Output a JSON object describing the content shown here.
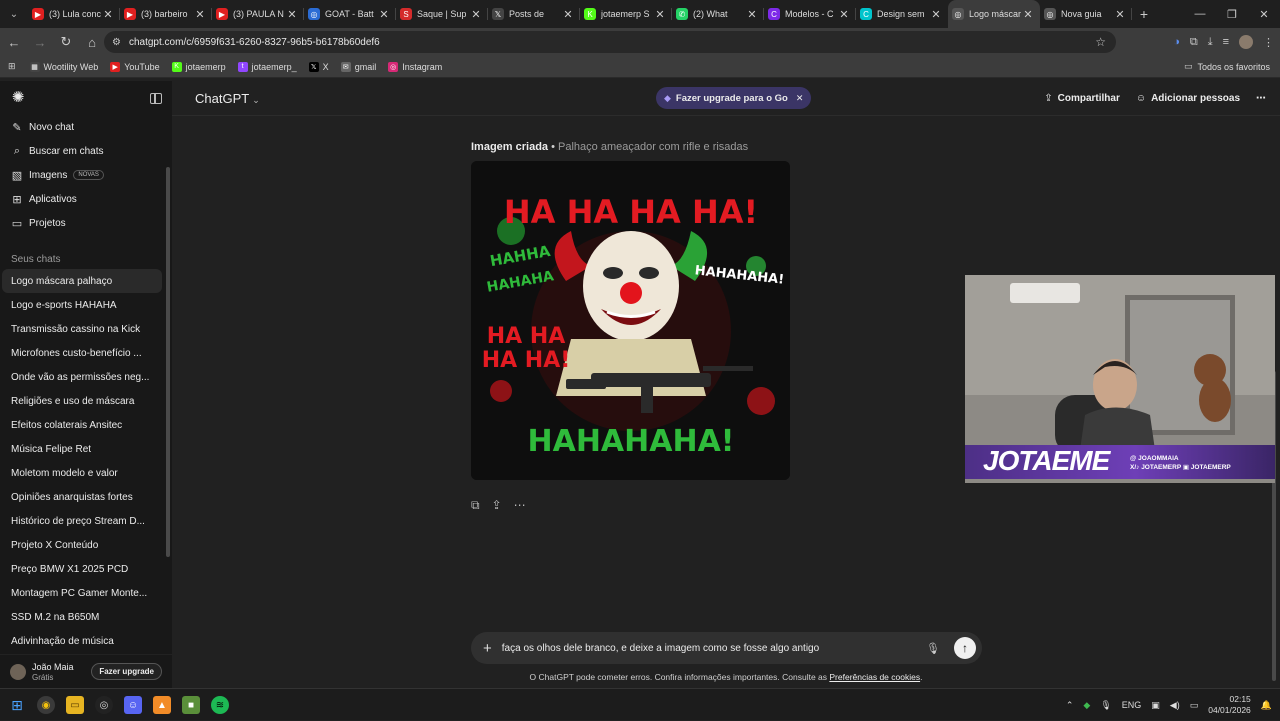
{
  "browser": {
    "tabs": [
      {
        "label": "(3) Lula conc",
        "fav_color": "#e02020",
        "fav": "▶"
      },
      {
        "label": "(3) barbeiro",
        "fav_color": "#e02020",
        "fav": "▶"
      },
      {
        "label": "(3) PAULA N",
        "fav_color": "#e02020",
        "fav": "▶"
      },
      {
        "label": "GOAT - Batt",
        "fav_color": "#2b6cd4",
        "fav": "◎"
      },
      {
        "label": "Saque | Sup",
        "fav_color": "#d42b2b",
        "fav": "S"
      },
      {
        "label": "Posts de",
        "fav_color": "#444444",
        "fav": "𝕏"
      },
      {
        "label": "jotaemerp S",
        "fav_color": "#53fc18",
        "fav": "K"
      },
      {
        "label": "(2) What",
        "fav_color": "#25d366",
        "fav": "✆"
      },
      {
        "label": "Modelos - C",
        "fav_color": "#7d2ae8",
        "fav": "C"
      },
      {
        "label": "Design sem",
        "fav_color": "#00c4cc",
        "fav": "C"
      },
      {
        "label": "Logo máscar",
        "fav_color": "#555555",
        "fav": "◎"
      },
      {
        "label": "Nova guia",
        "fav_color": "#555555",
        "fav": "◎"
      }
    ],
    "url": "chatgpt.com/c/6959f631-6260-8327-96b5-b6178b60def6",
    "bookmarks": [
      {
        "label": "Wootility Web",
        "color": "#444444",
        "icon": "▦"
      },
      {
        "label": "YouTube",
        "color": "#e02020",
        "icon": "▶"
      },
      {
        "label": "jotaemerp",
        "color": "#53fc18",
        "icon": "K"
      },
      {
        "label": "jotaemerp_",
        "color": "#9146ff",
        "icon": "t"
      },
      {
        "label": "X",
        "color": "#000000",
        "icon": "𝕏"
      },
      {
        "label": "gmail",
        "color": "#666666",
        "icon": "✉"
      },
      {
        "label": "Instagram",
        "color": "#d62976",
        "icon": "◎"
      }
    ],
    "all_favorites": "Todos os favoritos"
  },
  "sidebar": {
    "nav": [
      {
        "label": "Novo chat",
        "icon": "✎"
      },
      {
        "label": "Buscar em chats",
        "icon": "⌕"
      },
      {
        "label": "Imagens",
        "icon": "▧",
        "badge": "NOVAS"
      },
      {
        "label": "Aplicativos",
        "icon": "⊞"
      },
      {
        "label": "Projetos",
        "icon": "▭"
      }
    ],
    "section_label": "Seus chats",
    "chats": [
      "Logo máscara palhaço",
      "Logo e-sports HAHAHA",
      "Transmissão cassino na Kick",
      "Microfones custo-benefício ...",
      "Onde vão as permissões neg...",
      "Religiões e uso de máscara",
      "Efeitos colaterais Ansitec",
      "Música Felipe Ret",
      "Moletom modelo e valor",
      "Opiniões anarquistas fortes",
      "Histórico de preço Stream D...",
      "Projeto X Conteúdo",
      "Preço BMW X1 2025 PCD",
      "Montagem PC Gamer Monte...",
      "SSD M.2 na B650M",
      "Adivinhação de música"
    ],
    "user": {
      "name": "João Maia",
      "plan": "Grátis",
      "upgrade": "Fazer upgrade"
    }
  },
  "header": {
    "model": "ChatGPT",
    "upgrade_pill": "Fazer upgrade para o Go",
    "share": "Compartilhar",
    "add_people": "Adicionar pessoas"
  },
  "message": {
    "title_bold": "Imagem criada",
    "title_sep": " • ",
    "title_sub": "Palhaço ameaçador com rifle e risadas",
    "image_texts": {
      "top": "HA HA HA HA!",
      "left1": "HAHHA",
      "left2": "HAHAHA",
      "right": "HAHAHAHA!",
      "mid1": "HA HA",
      "mid2": "HA HA!",
      "bottom": "HAHAHAHA!"
    }
  },
  "composer": {
    "value": "faça os olhos dele branco, e deixe a imagem como se fosse algo antigo"
  },
  "disclaimer": {
    "text": "O ChatGPT pode cometer erros. Confira informações importantes. Consulte as ",
    "link": "Preferências de cookies",
    "end": "."
  },
  "webcam": {
    "logo": "JOTAEME",
    "social1": "@ JOAOMMAIA",
    "social2": "X/♪ JOTAEMERP  ▣ JOTAEMERP"
  },
  "taskbar": {
    "lang": "ENG",
    "time": "02:15",
    "date": "04/01/2026"
  }
}
